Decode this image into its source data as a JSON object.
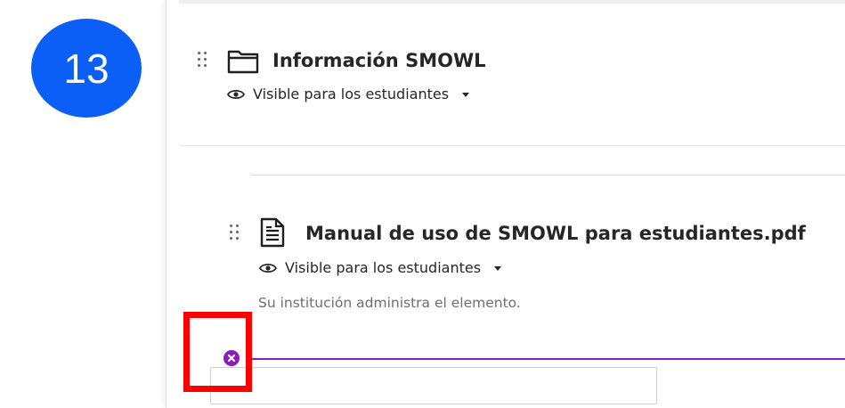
{
  "step": {
    "number": "13"
  },
  "folder": {
    "title": "Información SMOWL",
    "visibility_label": "Visible para los estudiantes"
  },
  "file": {
    "title": "Manual de uso de SMOWL para estudiantes.pdf",
    "visibility_label": "Visible para los estudiantes",
    "note": "Su institución administra el elemento."
  },
  "colors": {
    "step_badge": "#0b5ff6",
    "insert_line": "#8f1bb8",
    "highlight": "#ff0000"
  }
}
